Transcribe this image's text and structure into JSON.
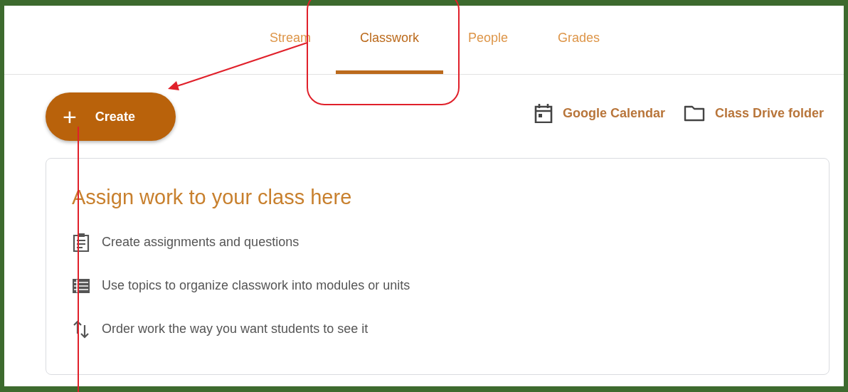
{
  "tabs": [
    {
      "label": "Stream",
      "selected": false
    },
    {
      "label": "Classwork",
      "selected": true
    },
    {
      "label": "People",
      "selected": false
    },
    {
      "label": "Grades",
      "selected": false
    }
  ],
  "create_button": {
    "icon": "+",
    "label": "Create"
  },
  "links": [
    {
      "kind": "calendar",
      "label": "Google Calendar"
    },
    {
      "kind": "folder",
      "label": "Class Drive folder"
    }
  ],
  "card": {
    "title": "Assign work to your class here",
    "items": [
      {
        "kind": "assignment",
        "text": "Create assignments and questions"
      },
      {
        "kind": "topics",
        "text": "Use topics to organize classwork into modules or units"
      },
      {
        "kind": "order",
        "text": "Order work the way you want students to see it"
      }
    ]
  }
}
